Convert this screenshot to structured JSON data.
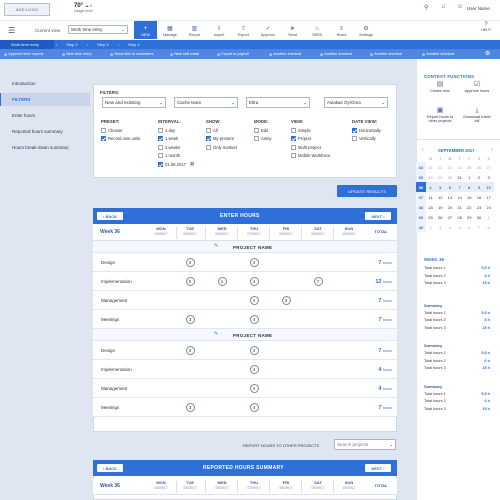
{
  "header": {
    "logo": "ADD LOGO",
    "temp": "70°",
    "weather_label": "Usage level",
    "user_name": "User Name",
    "help": "HELP"
  },
  "toolbar": {
    "current_view_label": "Current view",
    "current_view_value": "Work time entry",
    "items": [
      {
        "label": "NEW",
        "icon": "plus-icon"
      },
      {
        "label": "Manage",
        "icon": "grid-icon"
      },
      {
        "label": "Report",
        "icon": "chart-icon"
      },
      {
        "label": "Import",
        "icon": "import-icon"
      },
      {
        "label": "Export",
        "icon": "export-icon"
      },
      {
        "label": "Approve",
        "icon": "check-icon"
      },
      {
        "label": "Send",
        "icon": "send-icon"
      },
      {
        "label": "SEPA",
        "icon": "bank-icon"
      },
      {
        "label": "Rules",
        "icon": "rules-icon"
      },
      {
        "label": "Settings",
        "icon": "gear-icon"
      }
    ]
  },
  "steps": [
    "Work time entry",
    "Step 2",
    "Step 3",
    "Step 4"
  ],
  "shortcuts": [
    "Approve time reports",
    "New time entry",
    "Send bills to customers",
    "New skill mask",
    "Export to payroll",
    "Another shortcut",
    "Another shortcut",
    "Another shortcut",
    "Another shortcut"
  ],
  "sidebar": {
    "items": [
      "Introduction",
      "FILTERS",
      "Enter hours",
      "Reported hours summary",
      "Hours break-down summary"
    ]
  },
  "filters": {
    "title": "FILTERS:",
    "selects": [
      "New and exitsting",
      "Cache team",
      "Eltra",
      "Asiakas Oy/Oma"
    ],
    "groups": [
      {
        "title": "PRESET:",
        "options": [
          {
            "label": "Choose",
            "checked": false
          },
          {
            "label": "Record own units",
            "checked": true
          }
        ]
      },
      {
        "title": "INTERVAL:",
        "options": [
          {
            "label": "1 day",
            "checked": false
          },
          {
            "label": "1 week",
            "checked": true
          },
          {
            "label": "2 weeks",
            "checked": false
          },
          {
            "label": "1 month",
            "checked": false
          },
          {
            "label": "01.09.2017",
            "checked": true
          }
        ]
      },
      {
        "title": "SHOW:",
        "options": [
          {
            "label": "All",
            "checked": false
          },
          {
            "label": "My present",
            "checked": true
          },
          {
            "label": "Only marked",
            "checked": false
          }
        ]
      },
      {
        "title": "MODE:",
        "options": [
          {
            "label": "Edit",
            "checked": false
          },
          {
            "label": "Amity",
            "checked": false
          }
        ]
      },
      {
        "title": "VIEW:",
        "options": [
          {
            "label": "Simple",
            "checked": false
          },
          {
            "label": "Project",
            "checked": true
          },
          {
            "label": "Multi-project",
            "checked": false
          },
          {
            "label": "Mobile Workforce",
            "checked": false
          }
        ]
      },
      {
        "title": "DATE VIEW:",
        "options": [
          {
            "label": "Horizontally",
            "checked": true
          },
          {
            "label": "Vertically",
            "checked": false
          }
        ]
      }
    ],
    "update_label": "UPDATE RESULTS"
  },
  "enter_hours": {
    "title": "ENTER HOURS",
    "back": "BACK",
    "next": "NEXT",
    "week_label": "Week",
    "week_num": "36",
    "total_label": "TOTAL",
    "days": [
      {
        "d": "MON",
        "date": "04/09/17"
      },
      {
        "d": "TUE",
        "date": "05/09/17"
      },
      {
        "d": "WED",
        "date": "06/09/17"
      },
      {
        "d": "THU",
        "date": "07/09/17"
      },
      {
        "d": "FRI",
        "date": "08/09/17"
      },
      {
        "d": "SAT",
        "date": "09/09/17"
      },
      {
        "d": "SUN",
        "date": "10/09/17"
      }
    ],
    "projects": [
      {
        "name": "PROJECT NAME",
        "rows": [
          {
            "label": "Design",
            "hours": [
              "",
              "3",
              "",
              "4",
              "",
              "",
              ""
            ],
            "total": "7",
            "unit": "hours"
          },
          {
            "label": "Implementation",
            "hours": [
              "",
              "0",
              "1",
              "4",
              "",
              "7",
              ""
            ],
            "total": "12",
            "unit": "hours"
          },
          {
            "label": "Management",
            "hours": [
              "",
              "",
              "",
              "4",
              "3",
              "",
              ""
            ],
            "total": "7",
            "unit": "hours"
          },
          {
            "label": "Meetings",
            "hours": [
              "",
              "3",
              "",
              "4",
              "",
              "",
              ""
            ],
            "total": "7",
            "unit": "hours"
          }
        ]
      },
      {
        "name": "PROJECT NAME",
        "rows": [
          {
            "label": "Design",
            "hours": [
              "",
              "3",
              "",
              "4",
              "",
              "",
              ""
            ],
            "total": "7",
            "unit": "hours"
          },
          {
            "label": "Implementation",
            "hours": [
              "",
              "",
              "",
              "4",
              "",
              "",
              ""
            ],
            "total": "4",
            "unit": "hours"
          },
          {
            "label": "Management",
            "hours": [
              "",
              "",
              "",
              "4",
              "",
              "",
              ""
            ],
            "total": "4",
            "unit": "hours"
          },
          {
            "label": "Meetings",
            "hours": [
              "",
              "3",
              "",
              "4",
              "",
              "",
              ""
            ],
            "total": "7",
            "unit": "hours"
          }
        ]
      }
    ],
    "report_other_label": "REPORT HOURS TO OTHER PROJECTS",
    "search_placeholder": "Search projects"
  },
  "summary_panel": {
    "title": "REPORTED HOURS SUMMARY",
    "back": "BACK",
    "next": "NEXT",
    "week_label": "Week",
    "week_num": "36",
    "total_label": "TOTAL"
  },
  "context": {
    "title": "CONTEXT FUNCTIONS",
    "functions": [
      {
        "label": "Create new",
        "icon": "new-doc-icon"
      },
      {
        "label": "Approve hours",
        "icon": "approve-icon"
      },
      {
        "label": "Report hours to other projects",
        "icon": "report-icon"
      },
      {
        "label": "Download travel bill",
        "icon": "download-icon"
      }
    ]
  },
  "calendar": {
    "month": "SEPTEMBER 2017",
    "headers": [
      "",
      "M",
      "T",
      "W",
      "T",
      "F",
      "S",
      "S"
    ],
    "weeks": [
      [
        "34",
        "21",
        "22",
        "23",
        "24",
        "25",
        "26",
        "27"
      ],
      [
        "35",
        "28",
        "29",
        "30",
        "31",
        "1",
        "2",
        "3"
      ],
      [
        "36",
        "4",
        "5",
        "6",
        "7",
        "8",
        "9",
        "10"
      ],
      [
        "37",
        "11",
        "12",
        "13",
        "14",
        "15",
        "16",
        "17"
      ],
      [
        "38",
        "18",
        "19",
        "20",
        "21",
        "22",
        "23",
        "24"
      ],
      [
        "39",
        "25",
        "26",
        "27",
        "28",
        "29",
        "30",
        "1"
      ],
      [
        "40",
        "2",
        "3",
        "4",
        "5",
        "6",
        "7",
        "8"
      ]
    ]
  },
  "week_summary": {
    "title": "WEEK 36",
    "lines": [
      {
        "label": "Total hours 1",
        "value": "5,5 h"
      },
      {
        "label": "Total hours 2",
        "value": "6 h"
      },
      {
        "label": "Total hours 3",
        "value": "15 h"
      }
    ],
    "blocks": [
      {
        "title": "Summary",
        "lines": [
          {
            "label": "Total hours 1",
            "value": "5,5 h"
          },
          {
            "label": "Total hours 2",
            "value": "6 h"
          },
          {
            "label": "Total hours 3",
            "value": "15 h"
          }
        ]
      },
      {
        "title": "Summary",
        "lines": [
          {
            "label": "Total hours 1",
            "value": "5,5 h"
          },
          {
            "label": "Total hours 2",
            "value": "6 h"
          },
          {
            "label": "Total hours 3",
            "value": "15 h"
          }
        ]
      },
      {
        "title": "Summary",
        "lines": [
          {
            "label": "Total hours 1",
            "value": "5,5 h"
          },
          {
            "label": "Total hours 2",
            "value": "6 h"
          },
          {
            "label": "Total hours 3",
            "value": "15 h"
          }
        ]
      }
    ]
  }
}
